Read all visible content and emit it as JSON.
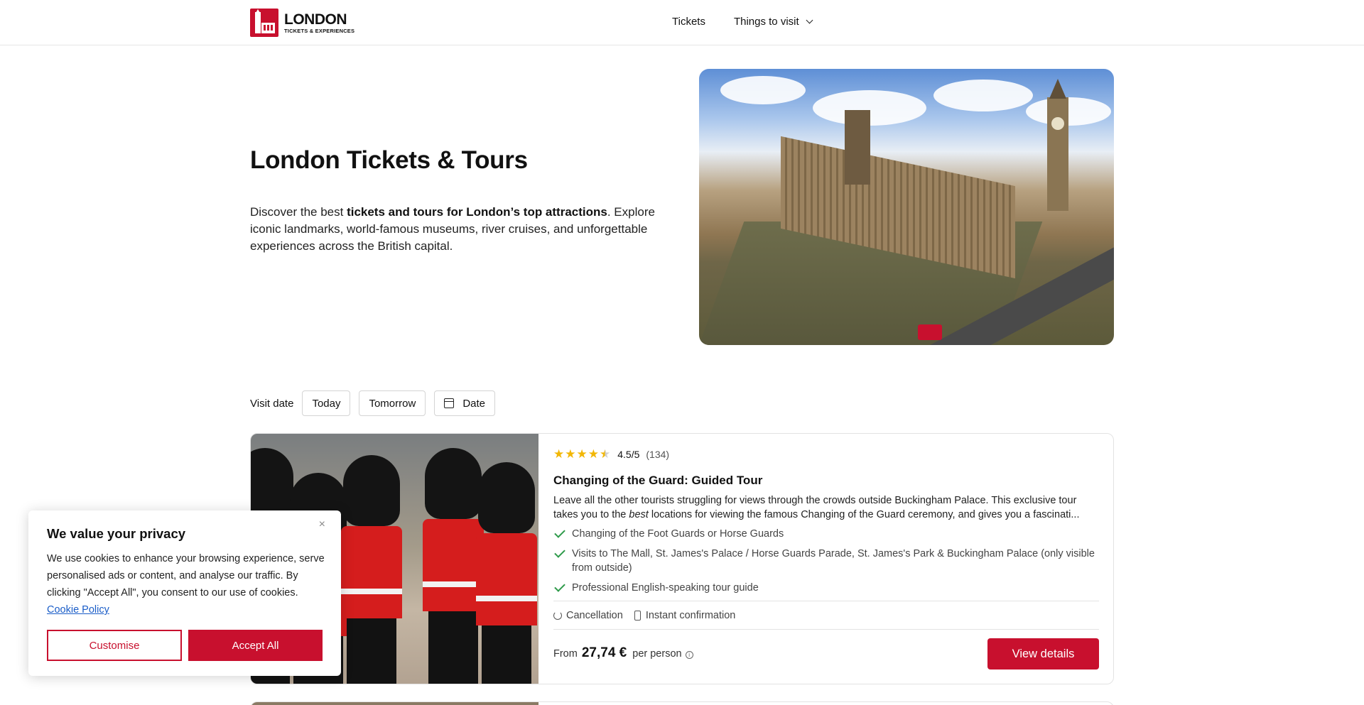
{
  "header": {
    "logo_title": "LONDON",
    "logo_subtitle": "TICKETS & EXPERIENCES",
    "nav": {
      "tickets": "Tickets",
      "things_to_visit": "Things to visit"
    }
  },
  "hero": {
    "title": "London Tickets & Tours",
    "desc_pre": "Discover the best ",
    "desc_bold": "tickets and tours for London’s top attractions",
    "desc_post": ". Explore iconic landmarks, world-famous museums, river cruises, and unforgettable experiences across the British capital."
  },
  "visit_date": {
    "label": "Visit date",
    "options": [
      "Today",
      "Tomorrow",
      "Date"
    ]
  },
  "card": {
    "rating_value": 4.5,
    "rating": "4.5/5",
    "reviews": "(134)",
    "title": "Changing of the Guard: Guided Tour",
    "desc_pre": "Leave all the other tourists struggling for views through the crowds outside Buckingham Palace. This exclusive tour takes you to the ",
    "desc_italic": "best",
    "desc_post": " locations for viewing the famous Changing of the Guard ceremony, and gives you a fascinati...",
    "features": [
      "Changing of the Foot Guards or Horse Guards",
      "Visits to The Mall, St. James's Palace / Horse Guards Parade, St. James's Park & Buckingham Palace (only visible from outside)",
      "Professional English-speaking tour guide"
    ],
    "policies": {
      "cancellation": "Cancellation",
      "instant": "Instant confirmation"
    },
    "price_from": "From",
    "price_amount": "27,74 €",
    "price_unit": "per person",
    "button": "View details"
  },
  "cookie": {
    "title": "We value your privacy",
    "text": "We use cookies to enhance your browsing experience, serve personalised ads or content, and analyse our traffic. By clicking \"Accept All\", you consent to our use of cookies.",
    "link": "Cookie Policy",
    "customise": "Customise",
    "accept": "Accept All",
    "close": "×"
  },
  "colors": {
    "brand_red": "#c8102e",
    "star": "#f2b705",
    "check_green": "#2e9a4a",
    "link": "#1a5dc8"
  },
  "icons": [
    "logo-icon",
    "chevron-down-icon",
    "calendar-icon",
    "star-icon",
    "check-icon",
    "refresh-icon",
    "phone-icon",
    "info-icon",
    "close-icon"
  ]
}
